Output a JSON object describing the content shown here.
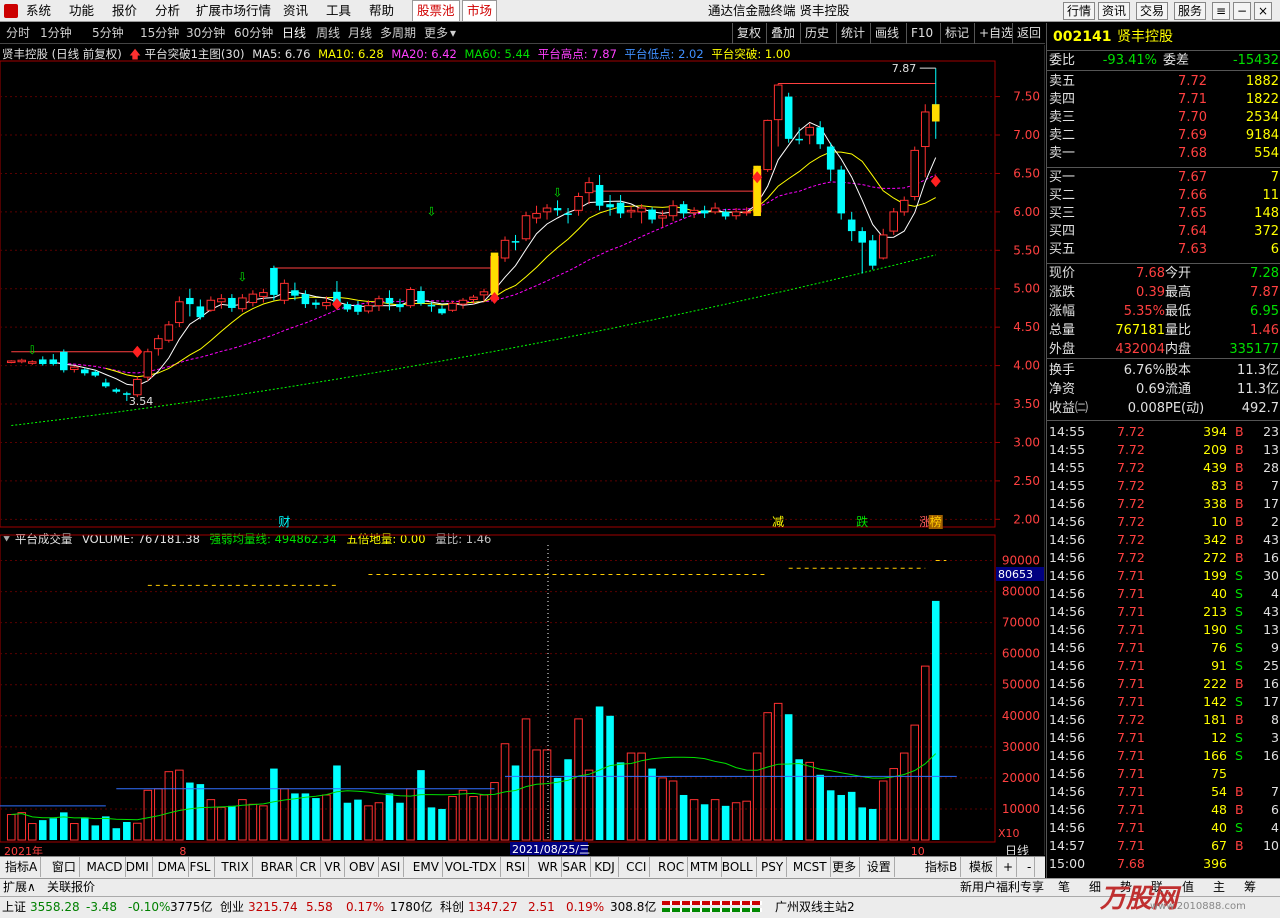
{
  "menu": {
    "items": [
      "系统",
      "功能",
      "报价",
      "分析",
      "扩展市场行情",
      "资讯",
      "工具",
      "帮助",
      "股票池",
      "市场"
    ],
    "title": "通达信金融终端  贤丰控股",
    "right_buttons": [
      "行情",
      "资讯",
      "交易",
      "服务"
    ]
  },
  "toolbar": {
    "periods": [
      "分时",
      "1分钟",
      "5分钟",
      "15分钟",
      "30分钟",
      "60分钟",
      "日线",
      "周线",
      "月线",
      "多周期",
      "更多"
    ],
    "selected": "日线",
    "tools": [
      "复权",
      "叠加",
      "历史",
      "统计",
      "画线",
      "F10",
      "标记",
      "+自选",
      "返回"
    ]
  },
  "chart_info": {
    "name": "贤丰控股 (日线 前复权)",
    "formula": "平台突破1主图(30)",
    "ma5": "MA5: 6.76",
    "ma10": "MA10: 6.28",
    "ma20": "MA20: 6.42",
    "ma60": "MA60: 5.44",
    "plat_high": "平台高点: 7.87",
    "plat_low": "平台低点: 2.02",
    "plat_break": "平台突破: 1.00"
  },
  "volume_info": {
    "name": "平台成交量",
    "volume": "VOLUME: 767181.38",
    "strong": "强弱均量线: 494862.34",
    "five": "五倍地量: 0.00",
    "ratio": "量比: 1.46"
  },
  "annotations": {
    "high_label": "7.87",
    "low_label": "3.54",
    "markers": [
      "财",
      "减",
      "跌",
      "涨",
      "榜"
    ],
    "date_label": "2021/08/25/三",
    "year_label": "2021年",
    "month8": "8",
    "month10": "10",
    "vol_cursor": "80653",
    "x10": "X10",
    "day": "日线"
  },
  "price_axis": [
    "7.50",
    "7.00",
    "6.50",
    "6.00",
    "5.50",
    "5.00",
    "4.50",
    "4.00",
    "3.50",
    "3.00",
    "2.50",
    "2.00"
  ],
  "volume_axis": [
    "90000",
    "80000",
    "70000",
    "60000",
    "50000",
    "40000",
    "30000",
    "20000",
    "10000"
  ],
  "chart_data": {
    "type": "candlestick",
    "series": [
      {
        "name": "MA5"
      },
      {
        "name": "MA10"
      },
      {
        "name": "MA20"
      },
      {
        "name": "MA60"
      }
    ],
    "ylim": [
      1.9,
      7.95
    ],
    "volume_ylim": [
      0,
      95000
    ],
    "candles": [
      [
        4.04,
        4.06,
        4.03,
        4.07,
        8.2,
        1
      ],
      [
        4.05,
        4.07,
        4.03,
        4.09,
        8.8,
        1
      ],
      [
        4.03,
        4.05,
        4.01,
        4.07,
        5.3,
        1
      ],
      [
        4.08,
        4.02,
        4.0,
        4.12,
        6.4,
        0
      ],
      [
        4.08,
        4.02,
        4.0,
        4.15,
        7.0,
        1
      ],
      [
        4.18,
        3.94,
        3.91,
        4.21,
        8.9,
        0
      ],
      [
        3.95,
        3.98,
        3.91,
        4.0,
        5.3,
        1
      ],
      [
        3.95,
        3.9,
        3.87,
        3.97,
        7.3,
        0
      ],
      [
        3.92,
        3.87,
        3.85,
        3.94,
        4.7,
        0
      ],
      [
        3.78,
        3.73,
        3.71,
        3.83,
        7.6,
        0
      ],
      [
        3.69,
        3.66,
        3.64,
        3.71,
        3.8,
        0
      ],
      [
        3.64,
        3.62,
        3.54,
        3.66,
        5.8,
        0
      ],
      [
        3.62,
        3.82,
        3.59,
        3.86,
        5.4,
        1
      ],
      [
        3.85,
        4.18,
        3.8,
        4.22,
        16.0,
        1
      ],
      [
        4.22,
        4.35,
        4.13,
        4.4,
        16.5,
        1
      ],
      [
        4.33,
        4.53,
        4.3,
        4.58,
        22.0,
        1
      ],
      [
        4.56,
        4.83,
        4.5,
        4.9,
        22.5,
        1
      ],
      [
        4.88,
        4.8,
        4.64,
        5.0,
        18.5,
        1
      ],
      [
        4.77,
        4.63,
        4.6,
        4.86,
        18.0,
        1
      ],
      [
        4.72,
        4.85,
        4.7,
        4.9,
        13.0,
        1
      ],
      [
        4.83,
        4.87,
        4.74,
        4.93,
        10.5,
        1
      ],
      [
        4.88,
        4.75,
        4.7,
        4.93,
        11.0,
        1
      ],
      [
        4.74,
        4.88,
        4.7,
        4.93,
        13.0,
        1
      ],
      [
        4.82,
        4.93,
        4.77,
        4.98,
        11.5,
        1
      ],
      [
        4.9,
        4.95,
        4.82,
        5.0,
        11.0,
        1
      ],
      [
        5.27,
        4.92,
        4.85,
        5.3,
        23.0,
        0
      ],
      [
        4.85,
        5.07,
        4.8,
        5.12,
        16.5,
        1
      ],
      [
        4.98,
        4.91,
        4.85,
        5.08,
        15.0,
        1
      ],
      [
        4.93,
        4.8,
        4.75,
        4.98,
        15.0,
        0
      ],
      [
        4.82,
        4.79,
        4.74,
        4.86,
        13.5,
        0
      ],
      [
        4.78,
        4.82,
        4.73,
        4.9,
        14.5,
        0
      ],
      [
        4.96,
        4.82,
        4.78,
        5.1,
        24.0,
        0
      ],
      [
        4.8,
        4.73,
        4.7,
        4.83,
        12.0,
        0
      ],
      [
        4.79,
        4.7,
        4.66,
        4.84,
        13.0,
        0
      ],
      [
        4.71,
        4.78,
        4.68,
        4.85,
        11.0,
        1
      ],
      [
        4.78,
        4.87,
        4.71,
        4.91,
        12.0,
        1
      ],
      [
        4.88,
        4.81,
        4.72,
        4.98,
        15.0,
        0
      ],
      [
        4.8,
        4.76,
        4.7,
        4.87,
        12.0,
        1
      ],
      [
        4.78,
        4.99,
        4.75,
        5.02,
        16.5,
        1
      ],
      [
        4.97,
        4.81,
        4.78,
        5.03,
        22.5,
        0
      ],
      [
        4.79,
        4.77,
        4.7,
        4.82,
        10.5,
        1
      ],
      [
        4.74,
        4.68,
        4.66,
        4.78,
        10.0,
        0
      ],
      [
        4.72,
        4.81,
        4.7,
        4.84,
        14.0,
        1
      ],
      [
        4.8,
        4.85,
        4.74,
        4.88,
        16.0,
        1
      ],
      [
        4.86,
        4.89,
        4.8,
        4.92,
        14.0,
        1
      ],
      [
        4.92,
        4.96,
        4.83,
        5.0,
        14.5,
        1
      ],
      [
        4.97,
        5.42,
        4.95,
        5.45,
        18.5,
        1
      ],
      [
        5.4,
        5.63,
        5.35,
        5.68,
        31.0,
        1
      ],
      [
        5.62,
        5.6,
        5.5,
        5.7,
        24.0,
        1
      ],
      [
        5.65,
        5.95,
        5.62,
        6.0,
        39.0,
        1
      ],
      [
        5.92,
        5.98,
        5.85,
        6.08,
        29.0,
        1
      ],
      [
        6.0,
        6.05,
        5.9,
        6.1,
        29.0,
        1
      ],
      [
        6.05,
        6.02,
        5.95,
        6.15,
        20.0,
        1
      ],
      [
        5.98,
        5.96,
        5.85,
        6.05,
        26.0,
        1
      ],
      [
        6.02,
        6.2,
        5.95,
        6.25,
        39.0,
        1
      ],
      [
        6.25,
        6.38,
        6.1,
        6.45,
        22.5,
        1
      ],
      [
        6.35,
        6.08,
        6.02,
        6.48,
        43.0,
        0
      ],
      [
        6.1,
        6.06,
        5.95,
        6.22,
        40.0,
        0
      ],
      [
        6.12,
        5.98,
        5.92,
        6.22,
        25.0,
        0
      ],
      [
        6.0,
        6.02,
        5.92,
        6.08,
        28.0,
        1
      ],
      [
        6.0,
        6.05,
        5.85,
        6.1,
        28.0,
        1
      ],
      [
        6.03,
        5.9,
        5.85,
        6.06,
        23.0,
        0
      ],
      [
        5.92,
        5.95,
        5.8,
        6.02,
        20.0,
        1
      ],
      [
        5.95,
        6.08,
        5.88,
        6.15,
        19.0,
        1
      ],
      [
        6.1,
        5.98,
        5.92,
        6.14,
        14.5,
        0
      ],
      [
        5.99,
        6.02,
        5.92,
        6.06,
        13.0,
        1
      ],
      [
        6.02,
        5.98,
        5.92,
        6.08,
        11.5,
        1
      ],
      [
        6.0,
        6.05,
        5.97,
        6.12,
        13.0,
        1
      ],
      [
        6.0,
        5.94,
        5.9,
        6.04,
        11.0,
        0
      ],
      [
        5.95,
        6.0,
        5.9,
        6.05,
        12.0,
        1
      ],
      [
        6.0,
        6.0,
        5.95,
        6.06,
        12.5,
        1
      ],
      [
        6.0,
        6.55,
        5.98,
        6.6,
        28.0,
        1
      ],
      [
        6.55,
        7.19,
        6.52,
        7.2,
        41.0,
        1
      ],
      [
        7.2,
        7.65,
        6.85,
        7.67,
        44.0,
        1
      ],
      [
        7.5,
        6.95,
        6.9,
        7.55,
        40.5,
        0
      ],
      [
        6.95,
        6.93,
        6.88,
        7.1,
        26.0,
        1
      ],
      [
        7.0,
        7.1,
        6.88,
        7.15,
        25.0,
        1
      ],
      [
        7.1,
        6.88,
        6.82,
        7.18,
        21.0,
        0
      ],
      [
        6.85,
        6.55,
        6.4,
        6.9,
        16.0,
        0
      ],
      [
        6.55,
        5.98,
        5.9,
        6.6,
        14.5,
        0
      ],
      [
        5.9,
        5.75,
        5.62,
        6.0,
        15.5,
        0
      ],
      [
        5.75,
        5.6,
        5.2,
        5.8,
        10.5,
        1
      ],
      [
        5.63,
        5.3,
        5.25,
        5.7,
        10.0,
        0
      ],
      [
        5.4,
        5.7,
        5.38,
        5.78,
        19.0,
        1
      ],
      [
        5.75,
        6.0,
        5.7,
        6.05,
        23.0,
        1
      ],
      [
        6.0,
        6.15,
        5.95,
        6.2,
        28.0,
        1
      ],
      [
        6.2,
        6.8,
        6.15,
        6.85,
        37.0,
        1
      ],
      [
        6.85,
        7.3,
        6.45,
        7.4,
        56.0,
        1
      ],
      [
        7.4,
        7.28,
        6.95,
        7.87,
        77.0,
        1
      ]
    ],
    "ma60_range": [
      3.22,
      5.44
    ]
  },
  "right_panel": {
    "code": "002141",
    "name": "贤丰控股",
    "weibi": {
      "label": "委比",
      "val": "-93.41%",
      "label2": "委差",
      "val2": "-15432"
    },
    "asks": [
      {
        "l": "卖五",
        "p": "7.72",
        "v": "1882"
      },
      {
        "l": "卖四",
        "p": "7.71",
        "v": "1822"
      },
      {
        "l": "卖三",
        "p": "7.70",
        "v": "2534"
      },
      {
        "l": "卖二",
        "p": "7.69",
        "v": "9184"
      },
      {
        "l": "卖一",
        "p": "7.68",
        "v": "554"
      }
    ],
    "bids": [
      {
        "l": "买一",
        "p": "7.67",
        "v": "7"
      },
      {
        "l": "买二",
        "p": "7.66",
        "v": "11"
      },
      {
        "l": "买三",
        "p": "7.65",
        "v": "148"
      },
      {
        "l": "买四",
        "p": "7.64",
        "v": "372"
      },
      {
        "l": "买五",
        "p": "7.63",
        "v": "6"
      }
    ],
    "stats": [
      {
        "l": "现价",
        "v": "7.68",
        "c": "red",
        "l2": "今开",
        "v2": "7.28",
        "c2": "green"
      },
      {
        "l": "涨跌",
        "v": "0.39",
        "c": "red",
        "l2": "最高",
        "v2": "7.87",
        "c2": "red"
      },
      {
        "l": "涨幅",
        "v": "5.35%",
        "c": "red",
        "l2": "最低",
        "v2": "6.95",
        "c2": "green"
      },
      {
        "l": "总量",
        "v": "767181",
        "c": "yellow",
        "l2": "量比",
        "v2": "1.46",
        "c2": "red"
      },
      {
        "l": "外盘",
        "v": "432004",
        "c": "red",
        "l2": "内盘",
        "v2": "335177",
        "c2": "green"
      },
      {
        "l": "换手",
        "v": "6.76%",
        "c": "white",
        "l2": "股本",
        "v2": "11.3亿",
        "c2": "white"
      },
      {
        "l": "净资",
        "v": "0.69",
        "c": "white",
        "l2": "流通",
        "v2": "11.3亿",
        "c2": "white"
      },
      {
        "l": "收益㈡",
        "v": "0.008",
        "c": "white",
        "l2": "PE(动)",
        "v2": "492.7",
        "c2": "white"
      }
    ],
    "ticks": [
      [
        "14:55",
        "7.72",
        "394",
        "B",
        "23"
      ],
      [
        "14:55",
        "7.72",
        "209",
        "B",
        "13"
      ],
      [
        "14:55",
        "7.72",
        "439",
        "B",
        "28"
      ],
      [
        "14:55",
        "7.72",
        "83",
        "B",
        "7"
      ],
      [
        "14:56",
        "7.72",
        "338",
        "B",
        "17"
      ],
      [
        "14:56",
        "7.72",
        "10",
        "B",
        "2"
      ],
      [
        "14:56",
        "7.72",
        "342",
        "B",
        "43"
      ],
      [
        "14:56",
        "7.72",
        "272",
        "B",
        "16"
      ],
      [
        "14:56",
        "7.71",
        "199",
        "S",
        "30"
      ],
      [
        "14:56",
        "7.71",
        "40",
        "S",
        "4"
      ],
      [
        "14:56",
        "7.71",
        "213",
        "S",
        "43"
      ],
      [
        "14:56",
        "7.71",
        "190",
        "S",
        "13"
      ],
      [
        "14:56",
        "7.71",
        "76",
        "S",
        "9"
      ],
      [
        "14:56",
        "7.71",
        "91",
        "S",
        "25"
      ],
      [
        "14:56",
        "7.71",
        "222",
        "B",
        "16"
      ],
      [
        "14:56",
        "7.71",
        "142",
        "S",
        "17"
      ],
      [
        "14:56",
        "7.72",
        "181",
        "B",
        "8"
      ],
      [
        "14:56",
        "7.71",
        "12",
        "S",
        "3"
      ],
      [
        "14:56",
        "7.71",
        "166",
        "S",
        "16"
      ],
      [
        "14:56",
        "7.71",
        "75",
        "",
        ""
      ],
      [
        "14:56",
        "7.71",
        "54",
        "B",
        "7"
      ],
      [
        "14:56",
        "7.71",
        "48",
        "B",
        "6"
      ],
      [
        "14:56",
        "7.71",
        "40",
        "S",
        "4"
      ],
      [
        "14:57",
        "7.71",
        "67",
        "B",
        "10"
      ],
      [
        "15:00",
        "7.68",
        "396",
        "",
        " "
      ]
    ]
  },
  "bottom_tabs": [
    "指标A",
    "窗口",
    "MACD",
    "DMI",
    "DMA",
    "FSL",
    "TRIX",
    "BRAR",
    "CR",
    "VR",
    "OBV",
    "ASI",
    "EMV",
    "VOL-TDX",
    "RSI",
    "WR",
    "SAR",
    "KDJ",
    "CCI",
    "ROC",
    "MTM",
    "BOLL",
    "PSY",
    "MCST",
    "更多",
    "设置"
  ],
  "bottom_right": [
    "指标B",
    "模板",
    "+",
    "-"
  ],
  "expand": {
    "left": "扩展∧",
    "quote": "关联报价",
    "promo": "新用户福利专享",
    "icons": [
      "笔",
      "细",
      "势",
      "联",
      "值",
      "主",
      "筹"
    ]
  },
  "status": {
    "sh_label": "上证",
    "sh_val": "3558.28",
    "sh_chg": "-3.48",
    "sh_pct": "-0.10%",
    "sh_amt": "3775亿",
    "cy_label": "创业",
    "cy_val": "3215.74",
    "cy_chg": "5.58",
    "cy_pct": "0.17%",
    "cy_amt": "1780亿",
    "kc_label": "科创",
    "kc_val": "1347.27",
    "kc_chg": "2.51",
    "kc_pct": "0.19%",
    "kc_amt": "308.8亿",
    "server": "广州双线主站2",
    "watermark": "万股网",
    "watermark_url": "www.2010888.com"
  },
  "colors": {
    "up": "#ff3030",
    "down": "#00ffff",
    "ma5": "#ffffff",
    "ma10": "#ffff00",
    "ma20": "#ff00ff",
    "ma60": "#00ff00"
  }
}
